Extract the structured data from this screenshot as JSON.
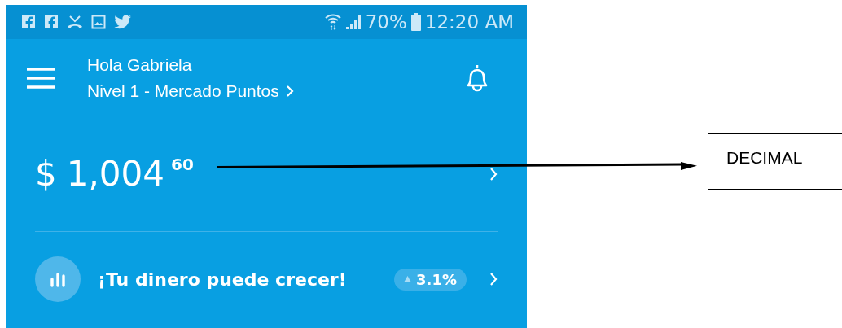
{
  "status_bar": {
    "battery": "70%",
    "time": "12:20 AM"
  },
  "header": {
    "greeting": "Hola Gabriela",
    "level_link": "Nivel 1 - Mercado Puntos"
  },
  "balance": {
    "currency": "$",
    "amount": "1,004",
    "decimals": "60"
  },
  "promo": {
    "text": "¡Tu dinero puede crecer!",
    "rate": "3.1%"
  },
  "annotation": {
    "label": "DECIMAL"
  }
}
